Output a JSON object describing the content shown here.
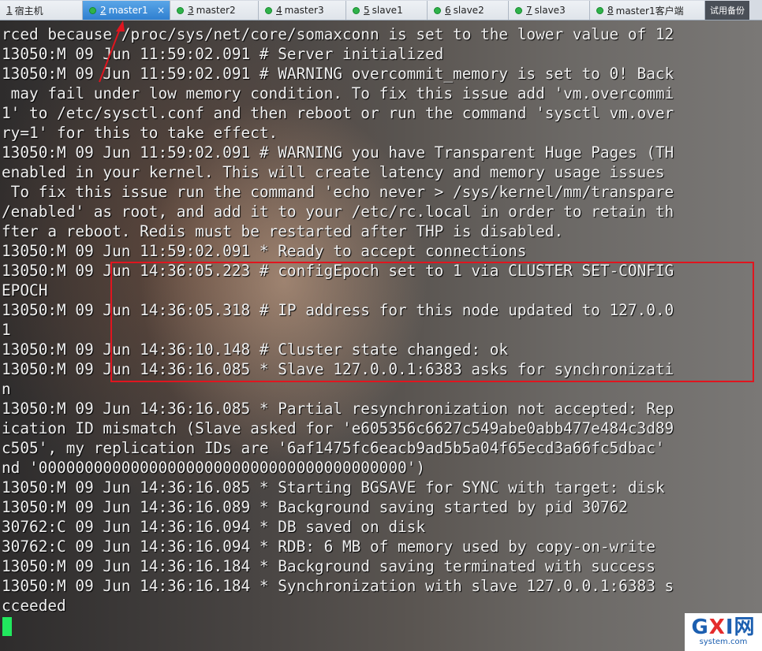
{
  "tabs": [
    {
      "num": "1",
      "label": "宿主机",
      "active": false,
      "dot": false
    },
    {
      "num": "2",
      "label": "master1",
      "active": true,
      "dot": true
    },
    {
      "num": "3",
      "label": "master2",
      "active": false,
      "dot": true
    },
    {
      "num": "4",
      "label": "master3",
      "active": false,
      "dot": true
    },
    {
      "num": "5",
      "label": "slave1",
      "active": false,
      "dot": true
    },
    {
      "num": "6",
      "label": "slave2",
      "active": false,
      "dot": true
    },
    {
      "num": "7",
      "label": "slave3",
      "active": false,
      "dot": true
    },
    {
      "num": "8",
      "label": "master1客户端",
      "active": false,
      "dot": true
    }
  ],
  "tab_close_glyph": "×",
  "tab_extra": "试用备份",
  "terminal": {
    "lines": [
      "rced because /proc/sys/net/core/somaxconn is set to the lower value of 12",
      "13050:M 09 Jun 11:59:02.091 # Server initialized",
      "13050:M 09 Jun 11:59:02.091 # WARNING overcommit_memory is set to 0! Back",
      " may fail under low memory condition. To fix this issue add 'vm.overcommi",
      "1' to /etc/sysctl.conf and then reboot or run the command 'sysctl vm.over",
      "ry=1' for this to take effect.",
      "13050:M 09 Jun 11:59:02.091 # WARNING you have Transparent Huge Pages (TH",
      "enabled in your kernel. This will create latency and memory usage issues",
      " To fix this issue run the command 'echo never > /sys/kernel/mm/transpare",
      "/enabled' as root, and add it to your /etc/rc.local in order to retain th",
      "fter a reboot. Redis must be restarted after THP is disabled.",
      "13050:M 09 Jun 11:59:02.091 * Ready to accept connections",
      "13050:M 09 Jun 14:36:05.223 # configEpoch set to 1 via CLUSTER SET-CONFIG",
      "EPOCH",
      "13050:M 09 Jun 14:36:05.318 # IP address for this node updated to 127.0.0",
      "1",
      "13050:M 09 Jun 14:36:10.148 # Cluster state changed: ok",
      "13050:M 09 Jun 14:36:16.085 * Slave 127.0.0.1:6383 asks for synchronizati",
      "n",
      "13050:M 09 Jun 14:36:16.085 * Partial resynchronization not accepted: Rep",
      "ication ID mismatch (Slave asked for 'e605356c6627c549abe0abb477e484c3d89",
      "c505', my replication IDs are '6af1475fc6eacb9ad5b5a04f65ecd3a66fc5dbac'",
      "nd '0000000000000000000000000000000000000000')",
      "13050:M 09 Jun 14:36:16.085 * Starting BGSAVE for SYNC with target: disk",
      "13050:M 09 Jun 14:36:16.089 * Background saving started by pid 30762",
      "30762:C 09 Jun 14:36:16.094 * DB saved on disk",
      "30762:C 09 Jun 14:36:16.094 * RDB: 6 MB of memory used by copy-on-write",
      "13050:M 09 Jun 14:36:16.184 * Background saving terminated with success",
      "13050:M 09 Jun 14:36:16.184 * Synchronization with slave 127.0.0.1:6383 s",
      "cceeded"
    ]
  },
  "annotation_color": "#e0151f",
  "cursor_color": "#21e85e",
  "watermark": {
    "main_g": "G",
    "main_x": "X",
    "main_i": "I",
    "main_rest": "网",
    "sub": "system.com"
  }
}
